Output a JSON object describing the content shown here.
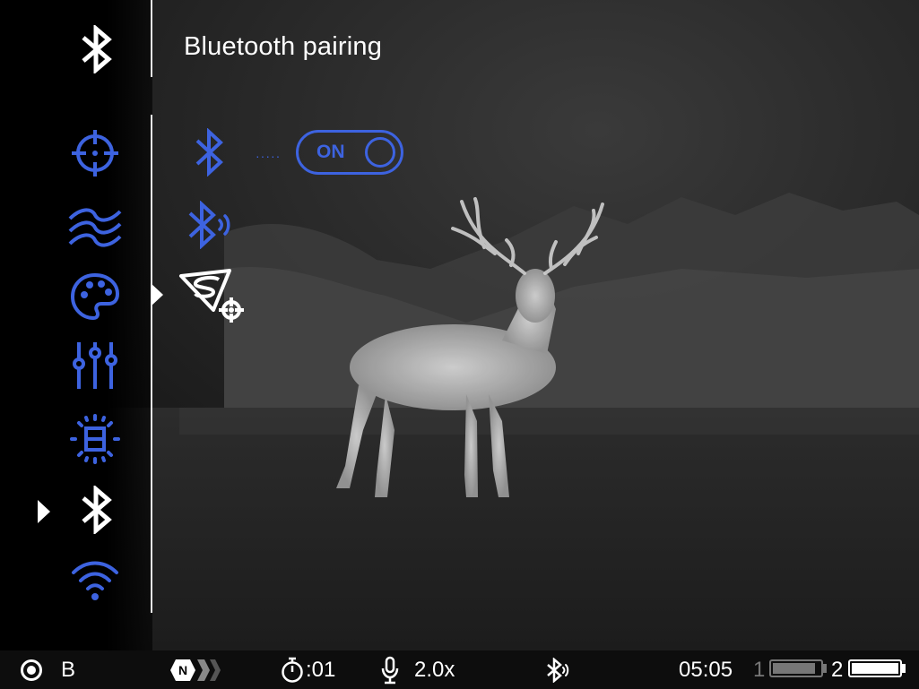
{
  "header": {
    "title": "Bluetooth pairing"
  },
  "colors": {
    "accent": "#3d63e0",
    "active": "#ffffff",
    "statusbar": "#0d0d0d"
  },
  "menu": {
    "items": [
      {
        "name": "crosshair-icon",
        "active": false
      },
      {
        "name": "waves-icon",
        "active": false
      },
      {
        "name": "palette-icon",
        "active": false
      },
      {
        "name": "sliders-icon",
        "active": false
      },
      {
        "name": "chip-icon",
        "active": false
      },
      {
        "name": "bluetooth-icon",
        "active": true
      },
      {
        "name": "wifi-icon",
        "active": false
      }
    ]
  },
  "submenu": {
    "bluetooth_toggle": {
      "label": "ON",
      "state": true
    },
    "items": [
      {
        "name": "bluetooth-icon"
      },
      {
        "name": "bluetooth-audio-icon"
      },
      {
        "name": "stream-vision-app-icon",
        "selected": true
      }
    ]
  },
  "statusbar": {
    "mode": "B",
    "timer": ":01",
    "zoom": "2.0x",
    "time": "05:05",
    "battery1_label": "1",
    "battery2_label": "2",
    "battery1_level": 0.9,
    "battery2_level": 1.0
  }
}
